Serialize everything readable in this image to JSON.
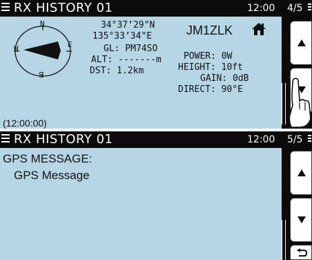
{
  "screen1": {
    "title": "RX HISTORY 01",
    "time": "12:00",
    "page": "4/5",
    "compass": {
      "n": "N",
      "e": "E",
      "s": "S",
      "w": "W"
    },
    "lat": "34°37’29\"N",
    "lon": "135°33’34\"E",
    "gl": "GL: PM74SO",
    "alt": "ALT: -------m",
    "dst": "DST: 1.2km",
    "callsign": "JM1ZLK",
    "power": "POWER: 0W",
    "height": "HEIGHT: 10ft",
    "gain": "GAIN: 0dB",
    "direct": "DIRECT: 90°E",
    "timestamp": "(12:00:00)"
  },
  "screen2": {
    "title": "RX HISTORY 01",
    "time": "12:00",
    "page": "5/5",
    "msg_heading": "GPS MESSAGE:",
    "msg_body": "GPS Message"
  },
  "icons": {
    "menu": "menu-icon",
    "home": "home-icon",
    "up": "up-arrow-icon",
    "down": "down-arrow-icon",
    "back": "back-icon",
    "hand": "pointing-hand-icon"
  },
  "colors": {
    "background": "#b6d6e6",
    "bar": "#0b0b0b",
    "button": "#ffffff"
  }
}
